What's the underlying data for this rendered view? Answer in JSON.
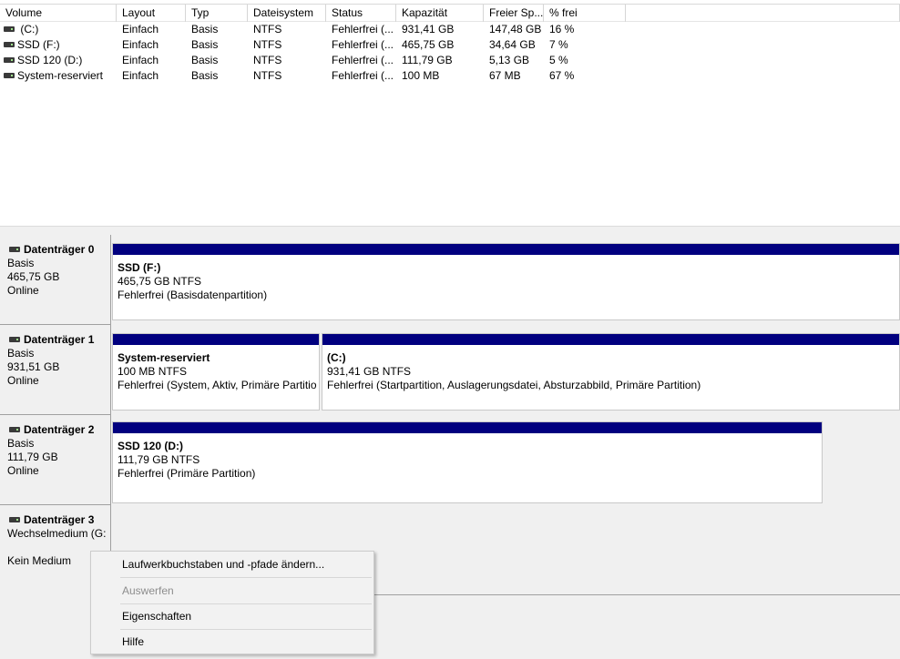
{
  "volume_list": {
    "columns": [
      "Volume",
      "Layout",
      "Typ",
      "Dateisystem",
      "Status",
      "Kapazität",
      "Freier Sp...",
      "% frei"
    ],
    "rows": [
      {
        "volume": " (C:)",
        "layout": "Einfach",
        "typ": "Basis",
        "fs": "NTFS",
        "status": "Fehlerfrei (...",
        "capacity": "931,41 GB",
        "free": "147,48 GB",
        "pct": "16 %"
      },
      {
        "volume": "SSD (F:)",
        "layout": "Einfach",
        "typ": "Basis",
        "fs": "NTFS",
        "status": "Fehlerfrei (...",
        "capacity": "465,75 GB",
        "free": "34,64 GB",
        "pct": "7 %"
      },
      {
        "volume": "SSD 120 (D:)",
        "layout": "Einfach",
        "typ": "Basis",
        "fs": "NTFS",
        "status": "Fehlerfrei (...",
        "capacity": "111,79 GB",
        "free": "5,13 GB",
        "pct": "5 %"
      },
      {
        "volume": "System-reserviert",
        "layout": "Einfach",
        "typ": "Basis",
        "fs": "NTFS",
        "status": "Fehlerfrei (...",
        "capacity": "100 MB",
        "free": "67 MB",
        "pct": "67 %"
      }
    ]
  },
  "disks": [
    {
      "name": "Datenträger 0",
      "type": "Basis",
      "size": "465,75 GB",
      "state": "Online",
      "partitions": [
        {
          "name": "SSD  (F:)",
          "size": "465,75 GB NTFS",
          "status": "Fehlerfrei (Basisdatenpartition)"
        }
      ]
    },
    {
      "name": "Datenträger 1",
      "type": "Basis",
      "size": "931,51 GB",
      "state": "Online",
      "partitions": [
        {
          "name": "System-reserviert",
          "size": "100 MB NTFS",
          "status": "Fehlerfrei (System, Aktiv, Primäre Partition)"
        },
        {
          "name": " (C:)",
          "size": "931,41 GB NTFS",
          "status": "Fehlerfrei (Startpartition, Auslagerungsdatei, Absturzabbild, Primäre Partition)"
        }
      ]
    },
    {
      "name": "Datenträger 2",
      "type": "Basis",
      "size": "111,79 GB",
      "state": "Online",
      "partitions": [
        {
          "name": "SSD 120  (D:)",
          "size": "111,79 GB NTFS",
          "status": "Fehlerfrei (Primäre Partition)"
        }
      ]
    },
    {
      "name": "Datenträger 3",
      "type": "Wechselmedium (G:",
      "size": "",
      "state": "Kein Medium",
      "partitions": []
    }
  ],
  "context_menu": {
    "items": [
      {
        "label": "Laufwerkbuchstaben und -pfade ändern...",
        "enabled": true
      },
      {
        "label": "Auswerfen",
        "enabled": false
      },
      {
        "label": "Eigenschaften",
        "enabled": true
      },
      {
        "label": "Hilfe",
        "enabled": true
      }
    ]
  },
  "colors": {
    "partition_bar": "#01007f",
    "menu_background": "#f2f2f2",
    "disabled_text": "#8d8d8d"
  },
  "icons": {
    "volume": "drive-icon",
    "disk": "disk-icon"
  }
}
